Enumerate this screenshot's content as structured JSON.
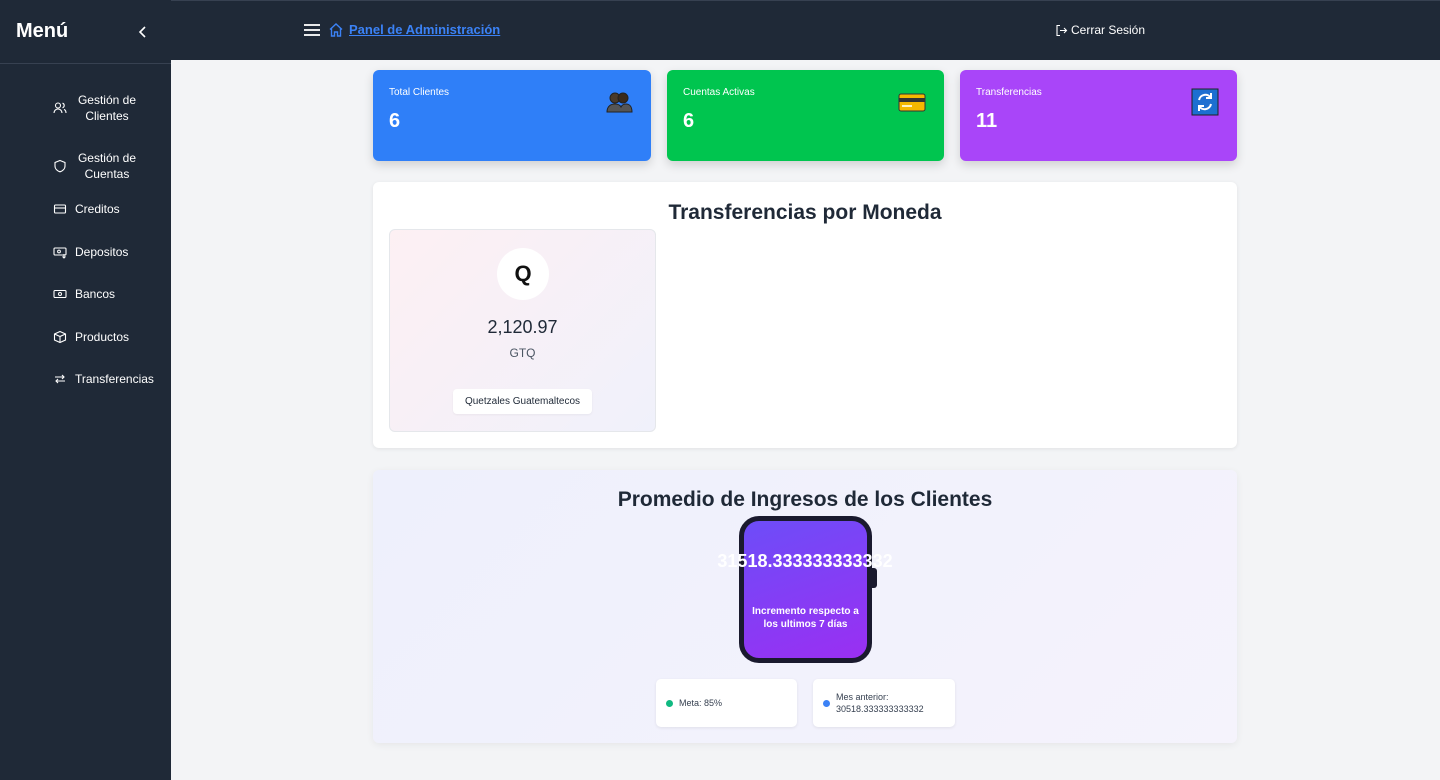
{
  "sidebar": {
    "title": "Menú",
    "items": [
      {
        "label": "Gestión de Clientes",
        "icon": "users-icon"
      },
      {
        "label": "Gestión de Cuentas",
        "icon": "shield-icon"
      },
      {
        "label": "Creditos",
        "icon": "credit-card-icon"
      },
      {
        "label": "Depositos",
        "icon": "deposit-icon"
      },
      {
        "label": "Bancos",
        "icon": "banknote-icon"
      },
      {
        "label": "Productos",
        "icon": "box-icon"
      },
      {
        "label": "Transferencias",
        "icon": "transfer-icon"
      }
    ]
  },
  "topbar": {
    "breadcrumb": "Panel de Administración",
    "logout_label": "Cerrar Sesión"
  },
  "stats": [
    {
      "label": "Total Clientes",
      "value": "6",
      "color": "#2f7ff8",
      "icon": "people-icon"
    },
    {
      "label": "Cuentas Activas",
      "value": "6",
      "color": "#00c54f",
      "icon": "credit-card-icon"
    },
    {
      "label": "Transferencias",
      "value": "11",
      "color": "#a945f9",
      "icon": "refresh-icon"
    }
  ],
  "transfers_panel": {
    "title": "Transferencias por Moneda",
    "currency": {
      "symbol": "Q",
      "amount": "2,120.97",
      "code": "GTQ",
      "name": "Quetzales Guatemaltecos"
    }
  },
  "income_panel": {
    "title": "Promedio de Ingresos de los Clientes",
    "value": "31518.333333333332",
    "caption": "Incremento respecto a los ultimos 7 días",
    "meta_label": "Meta: 85%",
    "prev_label": "Mes anterior: 30518.333333333332",
    "meta_color": "#10b981",
    "prev_color": "#3b82f6"
  }
}
